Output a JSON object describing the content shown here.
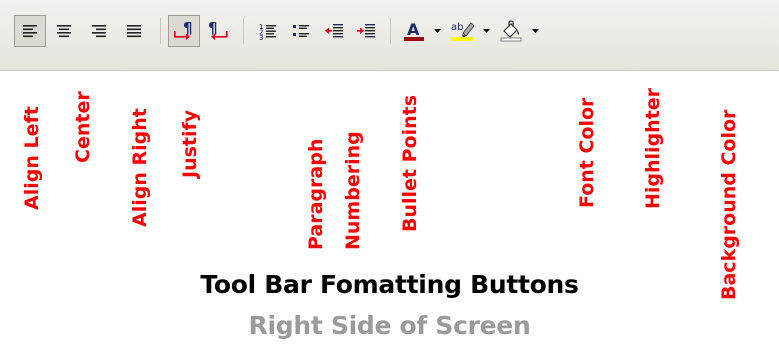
{
  "toolbar": {
    "buttons": [
      {
        "name": "align-left",
        "icon": "align-left-icon",
        "pressed": true
      },
      {
        "name": "center",
        "icon": "align-center-icon",
        "pressed": false
      },
      {
        "name": "align-right",
        "icon": "align-right-icon",
        "pressed": false
      },
      {
        "name": "justify",
        "icon": "justify-icon",
        "pressed": false
      },
      {
        "name": "paragraph-ltr",
        "icon": "paragraph-ltr-icon",
        "pressed": true
      },
      {
        "name": "paragraph-rtl",
        "icon": "paragraph-rtl-icon",
        "pressed": false
      },
      {
        "name": "numbering",
        "icon": "numbered-list-icon",
        "pressed": false
      },
      {
        "name": "bullets",
        "icon": "bullet-list-icon",
        "pressed": false
      },
      {
        "name": "decrease-indent",
        "icon": "decrease-indent-icon",
        "pressed": false
      },
      {
        "name": "increase-indent",
        "icon": "increase-indent-icon",
        "pressed": false
      },
      {
        "name": "font-color",
        "icon": "font-color-icon",
        "pressed": false,
        "color": "#9b0a12"
      },
      {
        "name": "highlighter",
        "icon": "highlighter-icon",
        "pressed": false,
        "color": "#ffff00"
      },
      {
        "name": "background-color",
        "icon": "background-color-icon",
        "pressed": false
      }
    ]
  },
  "labels": {
    "align_left": "Align Left",
    "center": "Center",
    "align_right": "Align Right",
    "justify": "Justify",
    "paragraph": "Paragraph",
    "numbering": "Numbering",
    "bullet_points": "Bullet Points",
    "font_color": "Font Color",
    "highlighter": "Highlighter",
    "background_color": "Background Color"
  },
  "caption": {
    "title": "Tool Bar Fomatting Buttons",
    "subtitle": "Right Side of Screen"
  },
  "colors": {
    "label": "#ff0000",
    "font_color_bar": "#9b0a12",
    "highlight": "#ffff00",
    "arrow": "#e8001c",
    "subtitle": "#9a9a9a"
  }
}
